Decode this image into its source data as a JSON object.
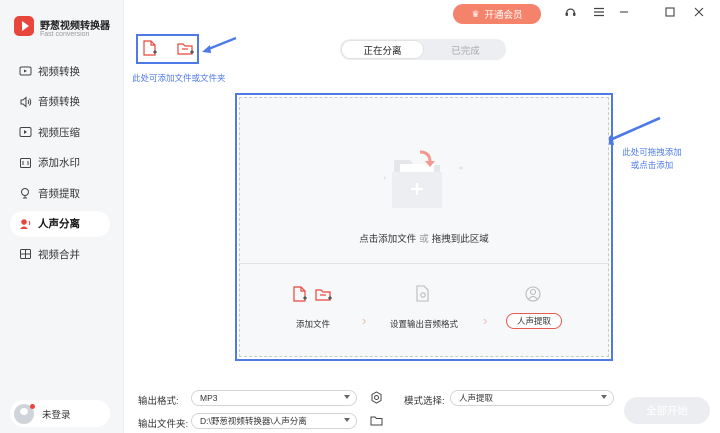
{
  "app": {
    "name": "野葱视频转换器",
    "subtitle": "Fast conversion",
    "brand_color": "#e8463c"
  },
  "sidebar": {
    "items": [
      {
        "label": "视频转换",
        "icon": "video-convert-icon",
        "active": false
      },
      {
        "label": "音频转换",
        "icon": "audio-convert-icon",
        "active": false
      },
      {
        "label": "视频压缩",
        "icon": "video-compress-icon",
        "active": false
      },
      {
        "label": "添加水印",
        "icon": "watermark-icon",
        "active": false
      },
      {
        "label": "音频提取",
        "icon": "audio-extract-icon",
        "active": false
      },
      {
        "label": "人声分离",
        "icon": "vocal-separate-icon",
        "active": true
      },
      {
        "label": "视频合并",
        "icon": "video-merge-icon",
        "active": false
      }
    ],
    "user_label": "未登录"
  },
  "titlebar": {
    "vip_label": "开通会员",
    "vip_color": "#f5826a"
  },
  "tabs": {
    "active": "正在分离",
    "inactive": "已完成"
  },
  "annotations": {
    "top_hint": "此处可添加文件或文件夹",
    "right_hint_line1": "此处可拖拽添加",
    "right_hint_line2": "或点击添加",
    "color": "#4e7ae8"
  },
  "dropzone": {
    "main_text_a": "点击添加文件",
    "main_text_or": "或",
    "main_text_b": "拖拽到此区域",
    "step1": "添加文件",
    "step2": "设置输出音频格式",
    "step3": "人声提取"
  },
  "bottom": {
    "format_label": "输出格式:",
    "format_value": "MP3",
    "mode_label": "模式选择:",
    "mode_value": "人声提取",
    "folder_label": "输出文件夹:",
    "folder_value": "D:\\野葱视频转换器\\人声分离",
    "start_label": "全部开始"
  }
}
